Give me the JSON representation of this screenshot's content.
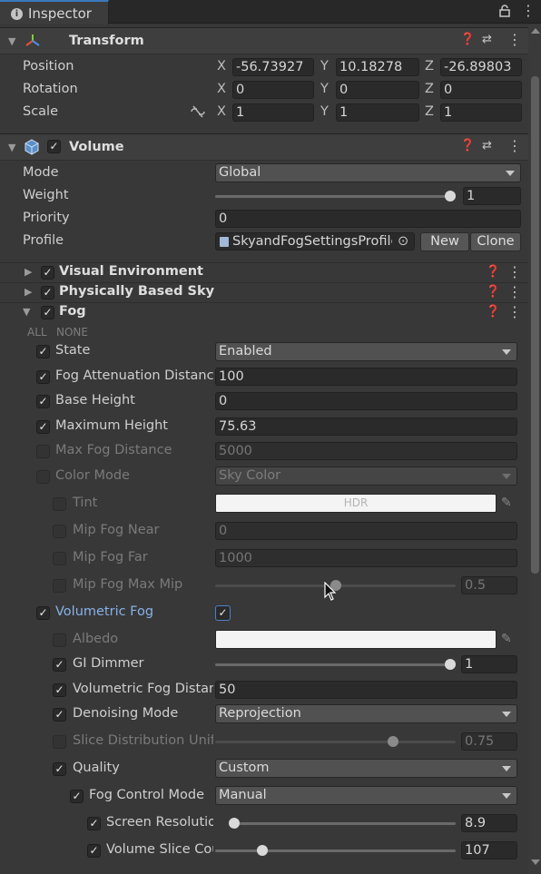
{
  "tab": {
    "icon": "info-icon",
    "label": "Inspector"
  },
  "transform": {
    "title": "Transform",
    "position": {
      "label": "Position",
      "x": "-56.73927",
      "y": "10.18278",
      "z": "-26.89803"
    },
    "rotation": {
      "label": "Rotation",
      "x": "0",
      "y": "0",
      "z": "0"
    },
    "scale": {
      "label": "Scale",
      "x": "1",
      "y": "1",
      "z": "1"
    },
    "axis": {
      "x": "X",
      "y": "Y",
      "z": "Z"
    }
  },
  "volume": {
    "title": "Volume",
    "mode_label": "Mode",
    "mode_value": "Global",
    "weight_label": "Weight",
    "weight_value": "1",
    "weight_level": 1.0,
    "priority_label": "Priority",
    "priority_value": "0",
    "profile_label": "Profile",
    "profile_value": "SkyandFogSettingsProfile",
    "new_btn": "New",
    "clone_btn": "Clone"
  },
  "overrides": {
    "visual_env": "Visual Environment",
    "pbs": "Physically Based Sky",
    "fog": "Fog",
    "all": "ALL",
    "none": "NONE"
  },
  "fog": {
    "state": {
      "label": "State",
      "value": "Enabled"
    },
    "atten": {
      "label": "Fog Attenuation Distance",
      "value": "100"
    },
    "base": {
      "label": "Base Height",
      "value": "0"
    },
    "maxh": {
      "label": "Maximum Height",
      "value": "75.63"
    },
    "maxdist": {
      "label": "Max Fog Distance",
      "value": "5000"
    },
    "colormode": {
      "label": "Color Mode",
      "value": "Sky Color"
    },
    "tint": {
      "label": "Tint",
      "value": "HDR"
    },
    "mipnear": {
      "label": "Mip Fog Near",
      "value": "0"
    },
    "mipfar": {
      "label": "Mip Fog Far",
      "value": "1000"
    },
    "mipmax": {
      "label": "Mip Fog Max Mip",
      "value": "0.5",
      "level": 0.5
    },
    "volfog": {
      "label": "Volumetric Fog"
    },
    "albedo": {
      "label": "Albedo"
    },
    "gidim": {
      "label": "GI Dimmer",
      "value": "1",
      "level": 1.0
    },
    "voldist": {
      "label": "Volumetric Fog Distance",
      "value": "50"
    },
    "denoise": {
      "label": "Denoising Mode",
      "value": "Reprojection"
    },
    "slice": {
      "label": "Slice Distribution Uniformity",
      "value": "0.75",
      "level": 0.75
    },
    "quality": {
      "label": "Quality",
      "value": "Custom"
    },
    "fcm": {
      "label": "Fog Control Mode",
      "value": "Manual"
    },
    "screenres": {
      "label": "Screen Resolution Percentage",
      "value": "8.9",
      "level": 0.0
    },
    "volslice": {
      "label": "Volume Slice Count",
      "value": "107",
      "level": 0.18
    }
  },
  "colors": {
    "accent": "#3a79bb",
    "link": "#87b1e8",
    "bg": "#383838"
  }
}
